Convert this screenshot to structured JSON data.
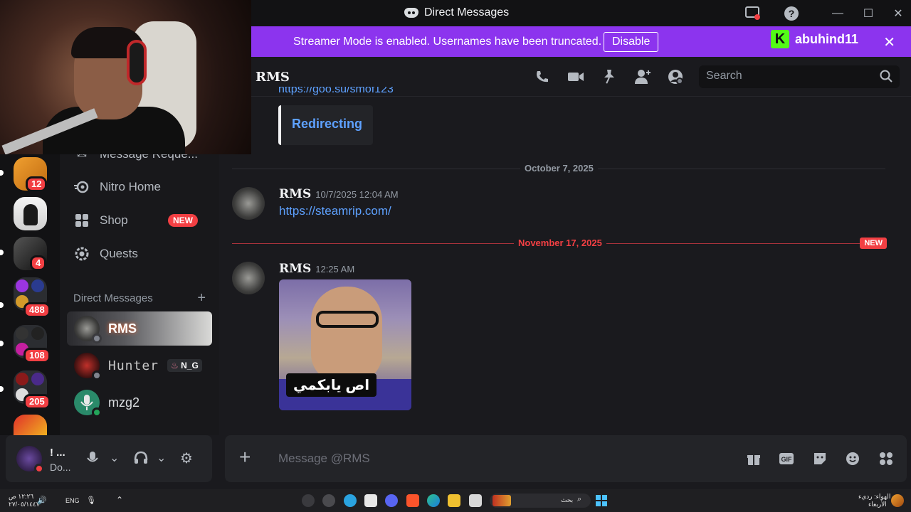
{
  "window": {
    "title": "Direct Messages"
  },
  "streamer": {
    "message": "Streamer Mode is enabled. Usernames have been truncated.",
    "disable_label": "Disable",
    "kick_username": "abuhind11"
  },
  "servers": [
    {
      "badge": "12"
    },
    {
      "badge": ""
    },
    {
      "badge": "4"
    },
    {
      "badge": "488"
    },
    {
      "badge": "108"
    },
    {
      "badge": "205"
    }
  ],
  "sidebar": {
    "truncated_item": "Message Reque...",
    "nitro": "Nitro Home",
    "shop": "Shop",
    "shop_badge": "NEW",
    "quests": "Quests",
    "dm_header": "Direct Messages",
    "dm_add": "+",
    "dms": [
      {
        "name": "RMS",
        "status": "offline"
      },
      {
        "name": "Hunter",
        "tag": "N_G",
        "status": "offline"
      },
      {
        "name": "mzg2",
        "status": "online"
      }
    ]
  },
  "user_panel": {
    "name": "! ...",
    "status": "Do..."
  },
  "chat": {
    "recipient": "RMS",
    "search_placeholder": "Search",
    "embed_title": "Redirecting",
    "dividers": [
      {
        "label": "October 7, 2025"
      },
      {
        "label": "November 17, 2025",
        "is_new": true,
        "new_label": "NEW"
      }
    ],
    "messages": [
      {
        "author": "RMS",
        "time": "10/7/2025 12:04 AM",
        "text": "https://steamrip.com/"
      },
      {
        "author": "RMS",
        "time": "12:25 AM",
        "attachment_caption": "اص يابكمي"
      }
    ],
    "composer_placeholder": "Message @RMS"
  },
  "taskbar": {
    "time": "١٢:٢٦ ص",
    "date": "٢٧/٠٥/١٤٤٧",
    "lang": "ENG",
    "search_label": "بحث",
    "weather": "الهواء: رديء",
    "weather_sub": "الأربعاء"
  },
  "colors": {
    "accent_purple": "#8c34ee",
    "link_blue": "#5ea1ff",
    "badge_red": "#f23f43",
    "online_green": "#23a55a",
    "kick_green": "#53fc18"
  }
}
